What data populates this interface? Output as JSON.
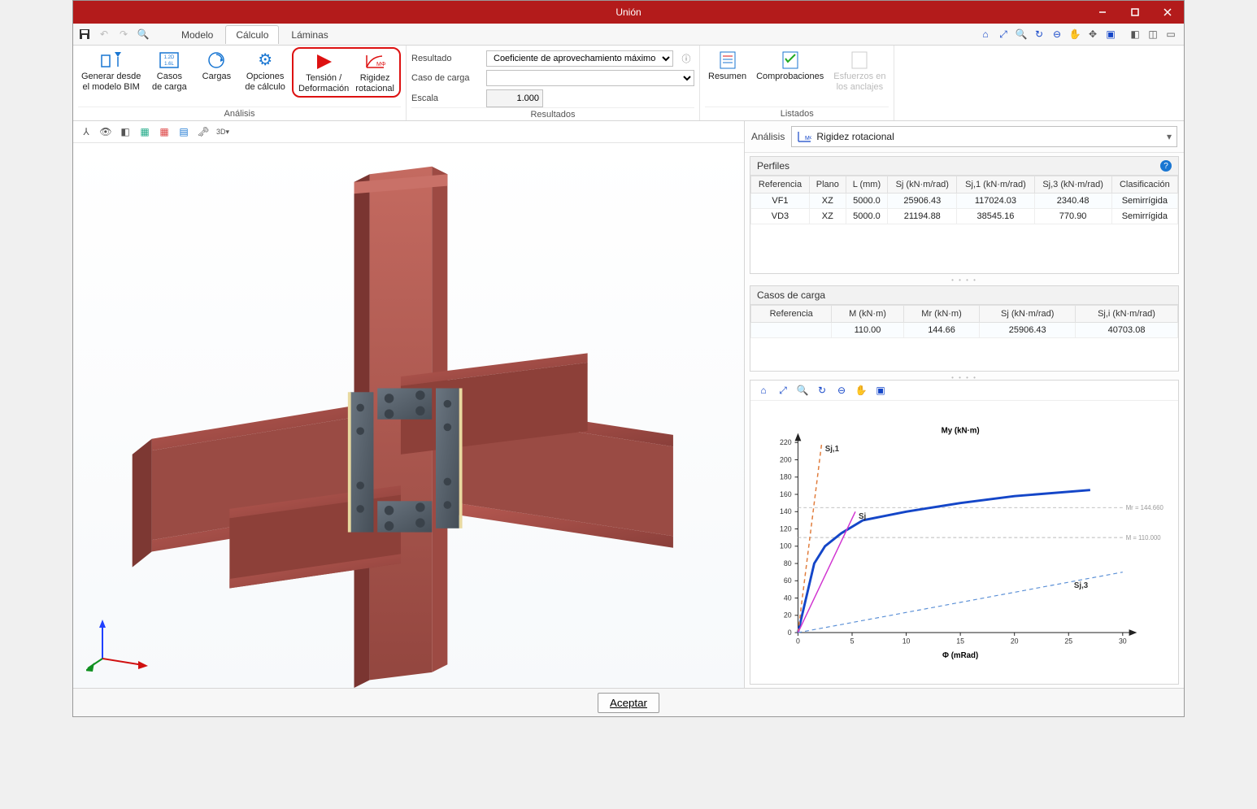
{
  "window": {
    "title": "Unión"
  },
  "tabs": {
    "model": "Modelo",
    "calc": "Cálculo",
    "sheets": "Láminas"
  },
  "ribbon": {
    "analysis_label": "Análisis",
    "results_label": "Resultados",
    "listings_label": "Listados",
    "gen_bim_l1": "Generar desde",
    "gen_bim_l2": "el modelo BIM",
    "cases_l1": "Casos",
    "cases_l2": "de carga",
    "loads": "Cargas",
    "options_l1": "Opciones",
    "options_l2": "de cálculo",
    "tension_l1": "Tensión /",
    "tension_l2": "Deformación",
    "stiff_l1": "Rigidez",
    "stiff_l2": "rotacional",
    "result_lbl": "Resultado",
    "case_lbl": "Caso de carga",
    "scale_lbl": "Escala",
    "result_sel": "Coeficiente de aprovechamiento máximo",
    "scale_val": "1.000",
    "summary": "Resumen",
    "checks": "Comprobaciones",
    "anchor_l1": "Esfuerzos en",
    "anchor_l2": "los anclajes"
  },
  "side": {
    "analysis_lbl": "Análisis",
    "analysis_sel": "Rigidez rotacional",
    "profiles_hdr": "Perfiles",
    "cases_hdr": "Casos de carga"
  },
  "profiles": {
    "cols": [
      "Referencia",
      "Plano",
      "L (mm)",
      "Sj (kN·m/rad)",
      "Sj,1 (kN·m/rad)",
      "Sj,3 (kN·m/rad)",
      "Clasificación"
    ],
    "rows": [
      [
        "VF1",
        "XZ",
        "5000.0",
        "25906.43",
        "117024.03",
        "2340.48",
        "Semirrígida"
      ],
      [
        "VD3",
        "XZ",
        "5000.0",
        "21194.88",
        "38545.16",
        "770.90",
        "Semirrígida"
      ]
    ]
  },
  "cases": {
    "cols": [
      "Referencia",
      "M (kN·m)",
      "Mr (kN·m)",
      "Sj (kN·m/rad)",
      "Sj,i (kN·m/rad)"
    ],
    "rows": [
      [
        "",
        "110.00",
        "144.66",
        "25906.43",
        "40703.08"
      ]
    ]
  },
  "footer": {
    "accept": "Aceptar"
  },
  "chart_data": {
    "type": "line",
    "title": "My (kN·m)",
    "xlabel": "Φ (mRad)",
    "ylabel": "",
    "xlim": [
      0,
      30
    ],
    "ylim": [
      0,
      220
    ],
    "x_ticks": [
      0,
      5,
      10,
      15,
      20,
      25,
      30
    ],
    "y_ticks": [
      0,
      20,
      40,
      60,
      80,
      100,
      120,
      140,
      160,
      180,
      200,
      220
    ],
    "series": [
      {
        "name": "curve",
        "x": [
          0,
          1.5,
          2.5,
          4,
          6,
          10,
          15,
          20,
          27
        ],
        "y": [
          0,
          80,
          100,
          115,
          130,
          140,
          150,
          158,
          165
        ],
        "color": "#1446c8",
        "style": "solid",
        "width": 3
      },
      {
        "name": "Sj,1",
        "x": [
          0,
          2.2
        ],
        "y": [
          0,
          220
        ],
        "color": "#e07b3a",
        "style": "dashed",
        "width": 1.5,
        "label_at": [
          2.5,
          210
        ]
      },
      {
        "name": "Sj",
        "x": [
          0,
          5.3
        ],
        "y": [
          0,
          140
        ],
        "color": "#d033d0",
        "style": "solid",
        "width": 1.5,
        "label_at": [
          5.6,
          132
        ]
      },
      {
        "name": "Sj,3",
        "x": [
          0,
          30
        ],
        "y": [
          0,
          70
        ],
        "color": "#5a8fd6",
        "style": "dashed",
        "width": 1.2,
        "label_at": [
          25.5,
          52
        ]
      }
    ],
    "hlines": [
      {
        "y": 110.0,
        "label": "M = 110.000"
      },
      {
        "y": 144.66,
        "label": "Mr = 144.660"
      }
    ]
  }
}
